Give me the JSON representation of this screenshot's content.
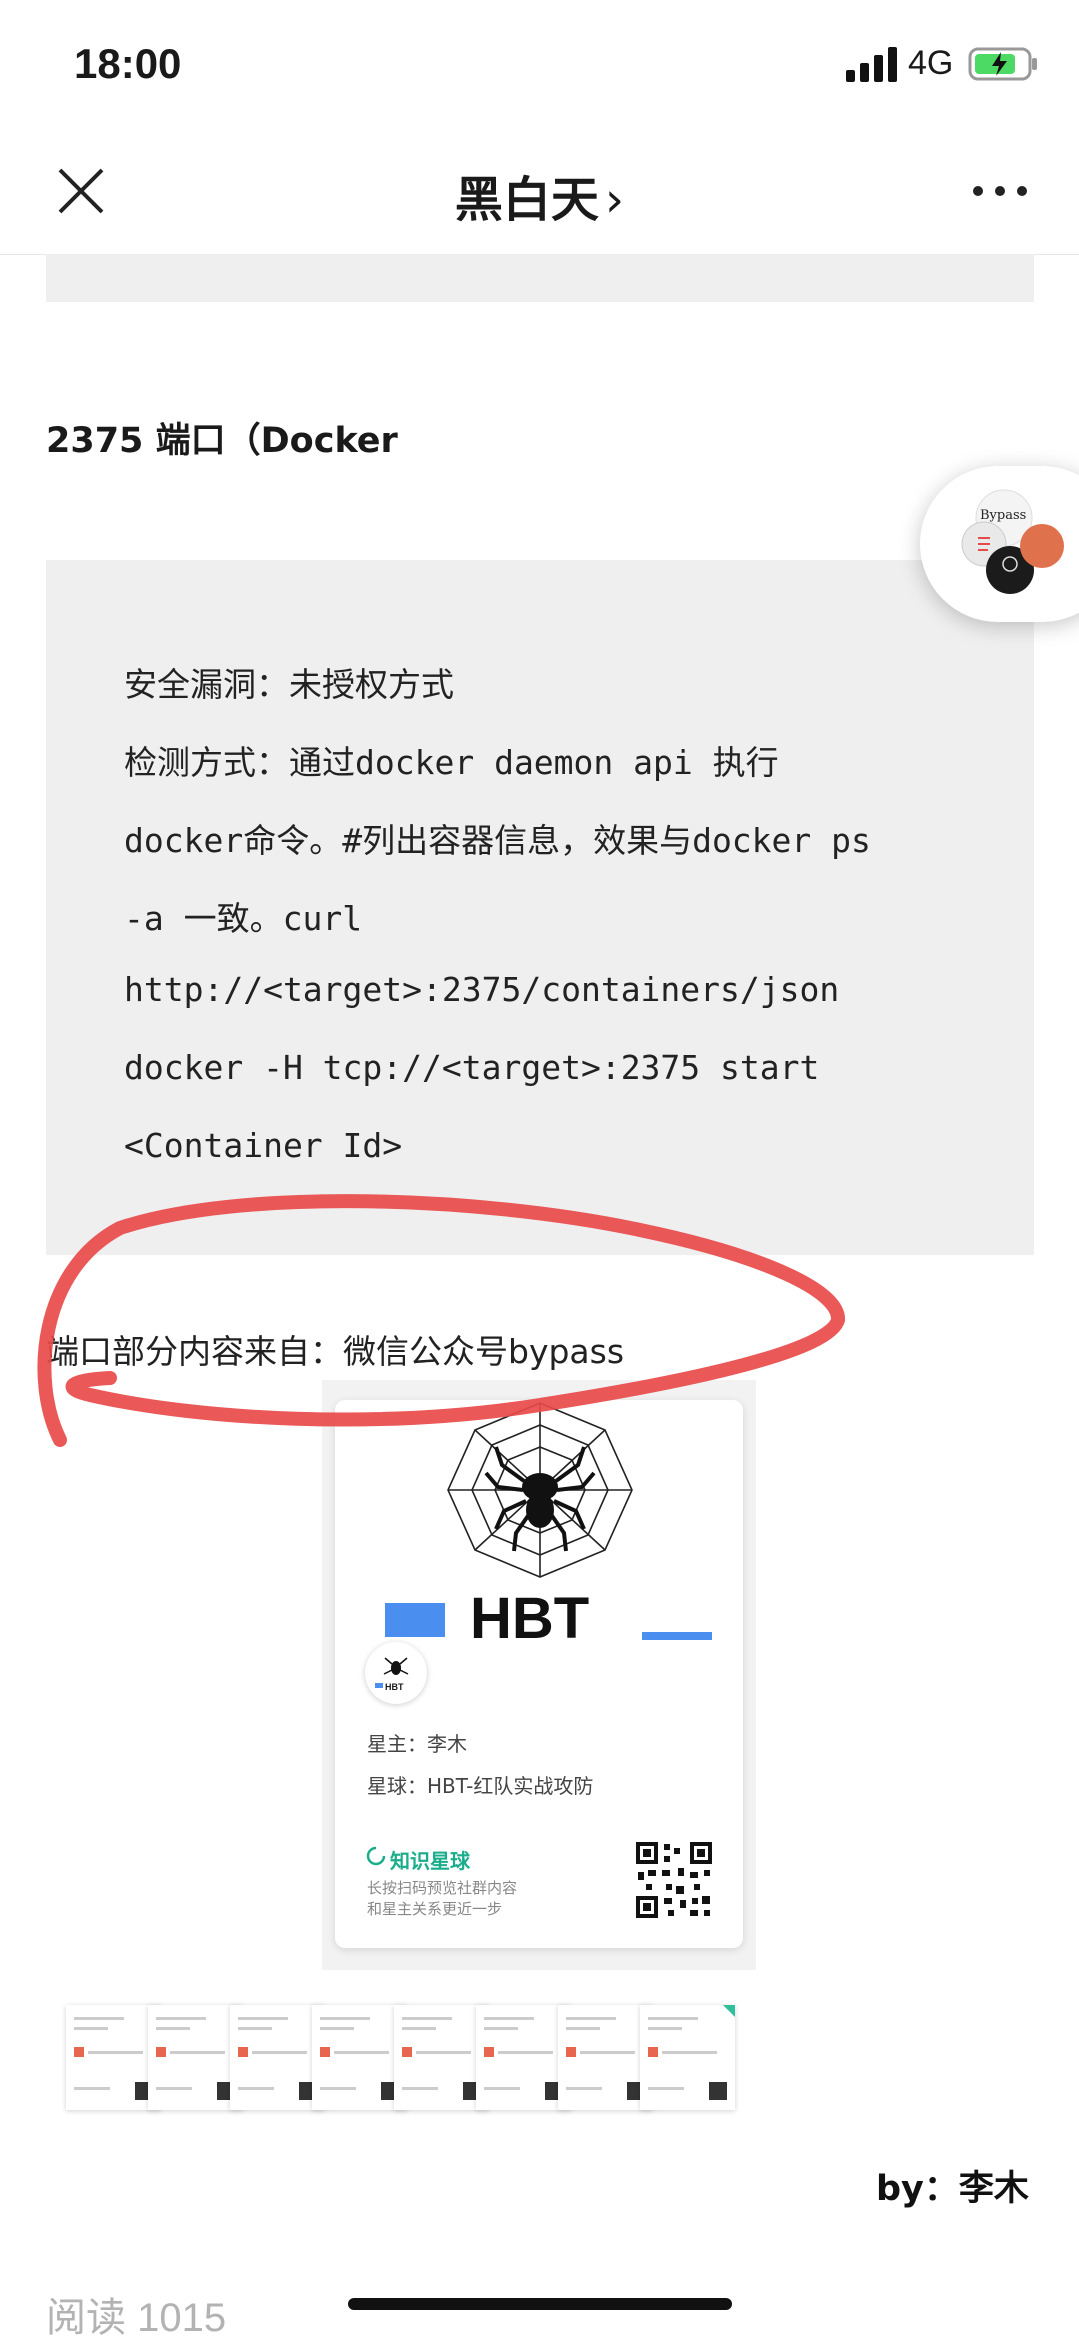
{
  "status_bar": {
    "time": "18:00",
    "network": "4G",
    "icons": [
      "signal-icon",
      "battery-charging-icon"
    ]
  },
  "nav": {
    "title": "黑白天",
    "chevron": "›",
    "icons": [
      "close-icon",
      "more-icon",
      "chevron-right-icon"
    ]
  },
  "article": {
    "section_heading": "2375 端口（Docker",
    "code_lines": [
      "安全漏洞：未授权方式",
      "检测方式：通过docker daemon api 执行",
      "docker命令。#列出容器信息，效果与docker ps",
      "-a 一致。curl",
      "http://<target>:2375/containers/json",
      "docker -H tcp://<target>:2375 start",
      "<Container Id>"
    ],
    "source_note": "端口部分内容来自：微信公众号bypass",
    "byline": "by：李木",
    "read_count": "阅读 1015"
  },
  "floating_widget": {
    "label": "Bypass"
  },
  "card": {
    "title": "HBT",
    "avatar_label": "HBT",
    "owner": "星主：李木",
    "planet": "星球：HBT-红队实战攻防",
    "zsxq": "知识星球",
    "desc_line1": "长按扫码预览社群内容",
    "desc_line2": "和星主关系更近一步",
    "icons": [
      "spider-web-logo",
      "qr-code-icon",
      "zsxq-logo-icon"
    ]
  },
  "thumbnails": {
    "count": 8
  },
  "colors": {
    "annotation_red": "#e84a4a",
    "code_bg": "#efefef",
    "brand_green": "#1aad8c",
    "accent_blue": "#4a8ef0"
  }
}
